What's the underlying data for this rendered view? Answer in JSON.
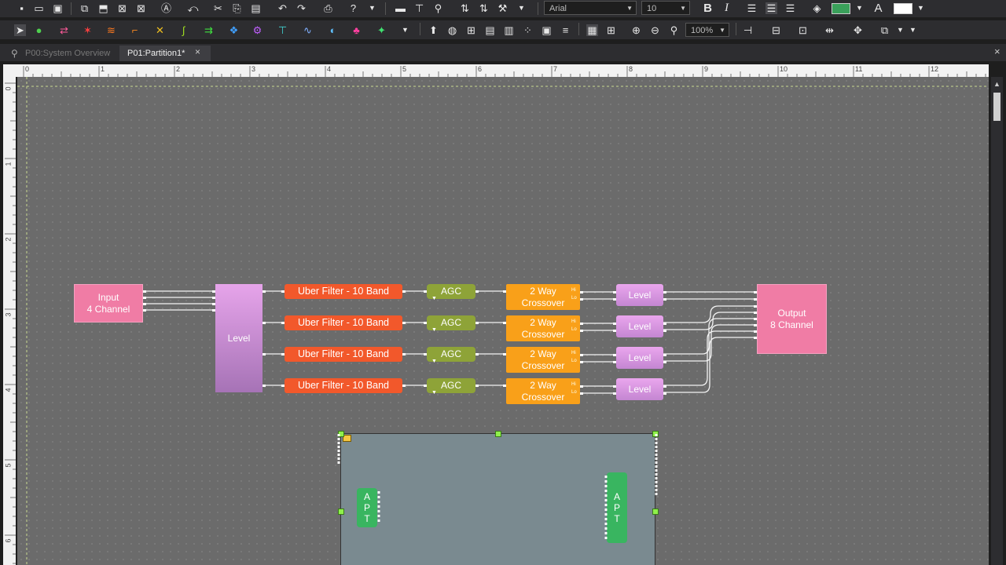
{
  "toolbar": {
    "row1_icons": [
      "new-icon",
      "open-icon",
      "save-icon",
      "new-design-icon",
      "export-icon",
      "close-design-icon",
      "close-all-icon",
      "text-box-icon",
      "undo-link-icon",
      "cut-icon",
      "copy-icon",
      "paste-icon",
      "undo-icon",
      "redo-icon",
      "print-icon",
      "help-icon",
      "dropdown-icon",
      "monitor-icon",
      "network-icon",
      "hierarchy-icon",
      "emulate-icon",
      "connect-icon",
      "tools-icon",
      "dropdown-icon"
    ],
    "font_name": "Arial",
    "font_size": "10",
    "bold_label": "B",
    "italic_label": "I",
    "text_color_label": "A",
    "fill_color": "#3aa05a",
    "text_color": "#ffffff",
    "row2_zoom": "100%"
  },
  "tabs": [
    {
      "label": "P00:System Overview",
      "active": false
    },
    {
      "label": "P01:Partition1*",
      "active": true
    }
  ],
  "tab_close": "×",
  "window_close": "×",
  "ruler": {
    "h_labels": [
      "0",
      "1",
      "2",
      "3",
      "4",
      "5",
      "6",
      "7",
      "8",
      "9",
      "10",
      "11",
      "12"
    ],
    "v_labels": [
      "0",
      "1",
      "2",
      "3",
      "4",
      "5",
      "6"
    ]
  },
  "blocks": {
    "input": {
      "line1": "Input",
      "line2": "4 Channel"
    },
    "level_main": "Level",
    "uber": [
      "Uber Filter - 10 Band",
      "Uber Filter - 10 Band",
      "Uber Filter - 10 Band",
      "Uber Filter - 10 Band"
    ],
    "agc": [
      "AGC",
      "AGC",
      "AGC",
      "AGC"
    ],
    "xover_line1": [
      "2 Way",
      "2 Way",
      "2 Way",
      "2 Way"
    ],
    "xover_line2": [
      "Crossover",
      "Crossover",
      "Crossover",
      "Crossover"
    ],
    "xover_hi": "Hi",
    "xover_lo": "Lo",
    "level_out": [
      "Level",
      "Level",
      "Level",
      "Level"
    ],
    "output": {
      "line1": "Output",
      "line2": "8 Channel"
    },
    "apt_left": [
      "A",
      "P",
      "T"
    ],
    "apt_right": [
      "A",
      "P",
      "T"
    ]
  },
  "colors": {
    "input": "#f07ca5",
    "uber": "#f2582b",
    "agc": "#8ea338",
    "crossover": "#f9a019",
    "level": "#d38ee0",
    "apt": "#39b560",
    "canvas": "#6b6b6b"
  }
}
